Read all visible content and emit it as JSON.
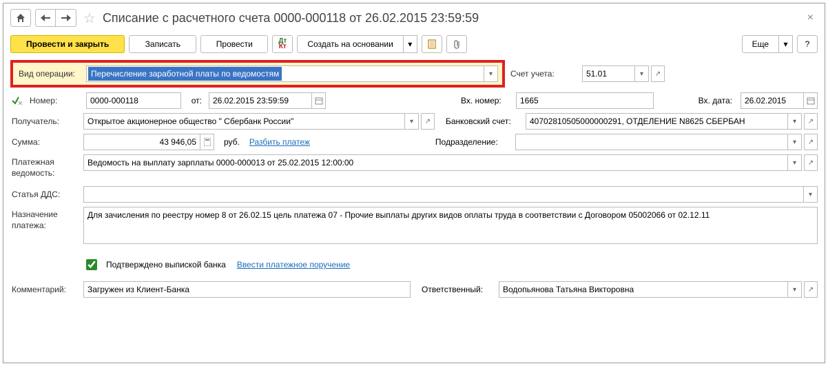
{
  "title": "Списание с расчетного счета 0000-000118 от 26.02.2015 23:59:59",
  "toolbar": {
    "post_close": "Провести и закрыть",
    "save": "Записать",
    "post": "Провести",
    "create_based": "Создать на основании",
    "more": "Еще"
  },
  "labels": {
    "op_type": "Вид операции:",
    "number": "Номер:",
    "from": "от:",
    "account": "Счет учета:",
    "in_number": "Вх. номер:",
    "in_date": "Вх. дата:",
    "recipient": "Получатель:",
    "bank_account": "Банковский счет:",
    "amount": "Сумма:",
    "currency": "руб.",
    "split": "Разбить платеж",
    "division": "Подразделение:",
    "pay_sheet": "Платежная ведомость:",
    "dds": "Статья ДДС:",
    "purpose": "Назначение платежа:",
    "confirmed": "Подтверждено выпиской банка",
    "enter_order": "Ввести платежное поручение",
    "comment": "Комментарий:",
    "responsible": "Ответственный:"
  },
  "values": {
    "op_type": "Перечисление заработной платы по ведомостям",
    "number": "0000-000118",
    "date": "26.02.2015 23:59:59",
    "account": "51.01",
    "in_number": "1665",
    "in_date": "26.02.2015",
    "recipient": "Открытое акционерное общество \" Сбербанк России\"",
    "bank_account": "40702810505000000291, ОТДЕЛЕНИЕ N8625 СБЕРБАН",
    "amount": "43 946,05",
    "pay_sheet": "Ведомость на выплату зарплаты 0000-000013 от 25.02.2015 12:00:00",
    "dds": "",
    "purpose": "Для зачисления по реестру номер 8 от 26.02.15 цель платежа 07 - Прочие выплаты других видов оплаты труда в соответствии с Договором 05002066 от 02.12.11",
    "comment": "Загружен из Клиент-Банка",
    "responsible": "Водопьянова Татьяна Викторовна"
  }
}
